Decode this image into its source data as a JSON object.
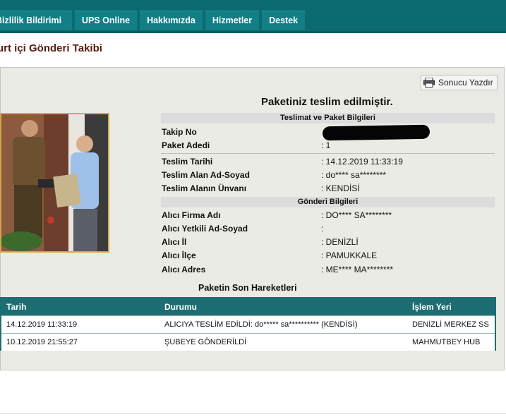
{
  "nav": {
    "tabs": [
      "Bizlilik Bildirimi",
      "UPS Online",
      "Hakkımızda",
      "Hizmetler",
      "Destek"
    ]
  },
  "page_title": "urt içi Gönderi Takibi",
  "print_button": "Sonucu Yazdır",
  "status_headline": "Paketiniz teslim edilmiştir.",
  "sections": {
    "delivery": "Teslimat ve Paket Bilgileri",
    "shipment": "Gönderi Bilgileri"
  },
  "fields": {
    "tracking_no": {
      "label": "Takip No",
      "value": ""
    },
    "package_count": {
      "label": "Paket Adedi",
      "value": ": 1"
    },
    "delivery_date": {
      "label": "Teslim Tarihi",
      "value": ": 14.12.2019 11:33:19"
    },
    "receiver_name": {
      "label": "Teslim Alan Ad-Soyad",
      "value": ": do**** sa********"
    },
    "receiver_title": {
      "label": "Teslim Alanın Ünvanı",
      "value": ": KENDİSİ"
    },
    "recipient_company": {
      "label": "Alıcı Firma Adı",
      "value": ": DO**** SA********"
    },
    "recipient_contact": {
      "label": "Alıcı Yetkili Ad-Soyad",
      "value": ":"
    },
    "recipient_city": {
      "label": "Alıcı İl",
      "value": ": DENİZLİ"
    },
    "recipient_district": {
      "label": "Alıcı İlçe",
      "value": ": PAMUKKALE"
    },
    "recipient_address": {
      "label": "Alıcı Adres",
      "value": ": ME**** MA********"
    }
  },
  "moves": {
    "title": "Paketin Son Hareketleri",
    "headers": [
      "Tarih",
      "Durumu",
      "İşlem Yeri"
    ],
    "rows": [
      [
        "14.12.2019 11:33:19",
        "ALICIYA TESLİM EDİLDİ: do***** sa********** (KENDİSİ)",
        "DENİZLİ MERKEZ SS"
      ],
      [
        "10.12.2019 21:55:27",
        "ŞUBEYE GÖNDERİLDİ",
        "MAHMUTBEY HUB"
      ]
    ]
  },
  "icons": {
    "print": "printer-icon"
  },
  "colors": {
    "nav_bg": "#0b6a70",
    "tab_bg": "#127f86",
    "title": "#5a1a10",
    "table_head": "#1c6e73"
  }
}
